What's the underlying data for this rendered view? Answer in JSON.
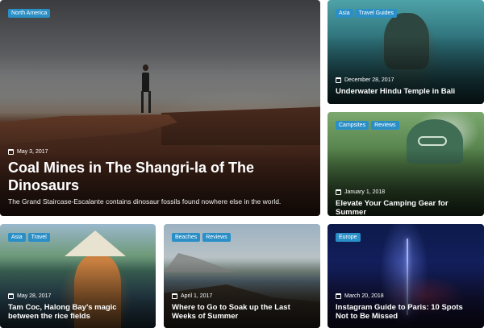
{
  "cards": [
    {
      "tags": [
        "North America"
      ],
      "date": "May 3, 2017",
      "title": "Coal Mines in The Shangri-la of The Dinosaurs",
      "excerpt": "The Grand Staircase-Escalante contains dinosaur fossils found nowhere else in the world."
    },
    {
      "tags": [
        "Asia",
        "Travel Guides"
      ],
      "date": "December 28, 2017",
      "title": "Underwater Hindu Temple in Bali"
    },
    {
      "tags": [
        "Campsites",
        "Reviews"
      ],
      "date": "January 1, 2018",
      "title": "Elevate Your Camping Gear for Summer"
    },
    {
      "tags": [
        "Asia",
        "Travel"
      ],
      "date": "May 28, 2017",
      "title": "Tam Coc, Halong Bay's magic between the rice fields"
    },
    {
      "tags": [
        "Beaches",
        "Reviews"
      ],
      "date": "April 1, 2017",
      "title": "Where to Go to Soak up the Last Weeks of Summer"
    },
    {
      "tags": [
        "Europe"
      ],
      "date": "March 20, 2018",
      "title": "Instagram Guide to Paris: 10 Spots Not to Be Missed"
    }
  ],
  "icons": {
    "date": "calendar-icon"
  },
  "colors": {
    "tag_bg": "#2b8fc7",
    "text": "#ffffff"
  }
}
